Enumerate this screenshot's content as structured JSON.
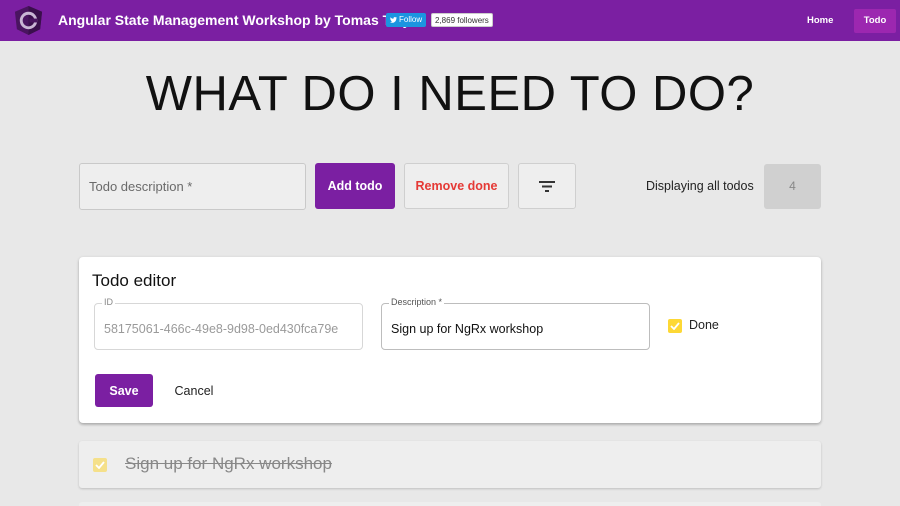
{
  "header": {
    "title": "Angular State Management Workshop by Tomas Trajan",
    "twitter_follow": "Follow",
    "twitter_followers": "2,869 followers",
    "nav": {
      "home": "Home",
      "todo": "Todo"
    }
  },
  "main": {
    "heading": "WHAT DO I NEED TO DO?",
    "todo_input_placeholder": "Todo description *",
    "add_button": "Add todo",
    "remove_button": "Remove done",
    "filter_icon": "filter-list-icon",
    "display_label": "Displaying all todos",
    "count": "4"
  },
  "editor": {
    "title": "Todo editor",
    "id_label": "ID",
    "id_value": "58175061-466c-49e8-9d98-0ed430fca79e",
    "description_label": "Description *",
    "description_value": "Sign up for NgRx workshop",
    "done_label": "Done",
    "done_checked": true,
    "save_button": "Save",
    "cancel_button": "Cancel"
  },
  "todos": [
    {
      "description": "Sign up for NgRx workshop",
      "done": true
    }
  ],
  "colors": {
    "primary": "#7b1fa2",
    "warn": "#e53935",
    "checkbox": "#fdd835"
  }
}
